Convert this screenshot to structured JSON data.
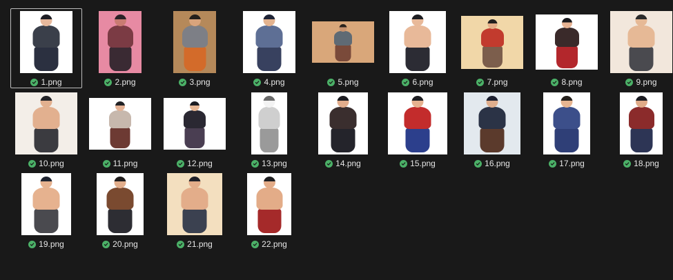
{
  "window": {
    "view": "file-grid"
  },
  "colors": {
    "background": "#191919",
    "label": "#e6e6e6",
    "sync_ok": "#4bb067",
    "selection": "#bdbdbd"
  },
  "files": [
    {
      "name": "1.png",
      "selected": true,
      "bg": "#ffffff",
      "skin": "#e6b89c",
      "hair": "#1e1e24",
      "top": "#3a3f4a",
      "bottom": "#2b3040",
      "icon": "check-circle-icon"
    },
    {
      "name": "2.png",
      "selected": false,
      "bg": "#e78aa3",
      "skin": "#c97b72",
      "hair": "#2a2026",
      "top": "#7b3b44",
      "bottom": "#3a2a33",
      "icon": "check-circle-icon"
    },
    {
      "name": "3.png",
      "selected": false,
      "bg": "#b5895a",
      "skin": "#d9a47c",
      "hair": "#24201c",
      "top": "#7d7f86",
      "bottom": "#d36b2a",
      "icon": "check-circle-icon"
    },
    {
      "name": "4.png",
      "selected": false,
      "bg": "#ffffff",
      "skin": "#e3b38f",
      "hair": "#1f2436",
      "top": "#5e6f95",
      "bottom": "#38415f",
      "icon": "check-circle-icon"
    },
    {
      "name": "5.png",
      "selected": false,
      "bg": "#d9a77a",
      "skin": "#c9936f",
      "hair": "#2a221c",
      "top": "#5f6a74",
      "bottom": "#7a4a3a",
      "icon": "check-circle-icon"
    },
    {
      "name": "6.png",
      "selected": false,
      "bg": "#ffffff",
      "skin": "#e8b999",
      "hair": "#1e1e22",
      "top": "#e8b999",
      "bottom": "#2c2c34",
      "icon": "check-circle-icon"
    },
    {
      "name": "7.png",
      "selected": false,
      "bg": "#f1d7a8",
      "skin": "#e3ad87",
      "hair": "#22201f",
      "top": "#c23b2e",
      "bottom": "#7c5e4c",
      "icon": "check-circle-icon"
    },
    {
      "name": "8.png",
      "selected": false,
      "bg": "#ffffff",
      "skin": "#e7b393",
      "hair": "#1a1a1e",
      "top": "#3a2a2a",
      "bottom": "#b3272c",
      "icon": "check-circle-icon"
    },
    {
      "name": "9.png",
      "selected": false,
      "bg": "#f2e7dc",
      "skin": "#e6b996",
      "hair": "#2b2b2b",
      "top": "#e6b996",
      "bottom": "#4a4a4f",
      "icon": "check-circle-icon"
    },
    {
      "name": "10.png",
      "selected": false,
      "bg": "#f3eee8",
      "skin": "#e2b08f",
      "hair": "#232327",
      "top": "#e2b08f",
      "bottom": "#3b3b40",
      "icon": "check-circle-icon"
    },
    {
      "name": "11.png",
      "selected": false,
      "bg": "#ffffff",
      "skin": "#e4b295",
      "hair": "#222225",
      "top": "#c7b8ad",
      "bottom": "#6d3a33",
      "icon": "check-circle-icon"
    },
    {
      "name": "12.png",
      "selected": false,
      "bg": "#ffffff",
      "skin": "#e8b896",
      "hair": "#1c1c22",
      "top": "#2a2832",
      "bottom": "#4a3e52",
      "icon": "check-circle-icon"
    },
    {
      "name": "13.png",
      "selected": false,
      "bg": "#ffffff",
      "skin": "#f3f3f3",
      "hair": "#6a6a6a",
      "top": "#cfcfcf",
      "bottom": "#9a9a9a",
      "icon": "check-circle-icon"
    },
    {
      "name": "14.png",
      "selected": false,
      "bg": "#ffffff",
      "skin": "#e2ad8c",
      "hair": "#1d1d22",
      "top": "#3a2e2e",
      "bottom": "#24242b",
      "icon": "check-circle-icon"
    },
    {
      "name": "15.png",
      "selected": false,
      "bg": "#ffffff",
      "skin": "#e6b18f",
      "hair": "#1e1e22",
      "top": "#c32c2c",
      "bottom": "#2c3f8c",
      "icon": "check-circle-icon"
    },
    {
      "name": "16.png",
      "selected": false,
      "bg": "#e3e9ee",
      "skin": "#dfae8d",
      "hair": "#1d2030",
      "top": "#2b3346",
      "bottom": "#5b3a2c",
      "icon": "check-circle-icon"
    },
    {
      "name": "17.png",
      "selected": false,
      "bg": "#ffffff",
      "skin": "#e7b591",
      "hair": "#25201c",
      "top": "#3c4f8a",
      "bottom": "#2f3f77",
      "icon": "check-circle-icon"
    },
    {
      "name": "18.png",
      "selected": false,
      "bg": "#ffffff",
      "skin": "#e0ab88",
      "hair": "#1c1c22",
      "top": "#8b2b2b",
      "bottom": "#2d3555",
      "icon": "check-circle-icon"
    },
    {
      "name": "19.png",
      "selected": false,
      "bg": "#ffffff",
      "skin": "#e6b28f",
      "hair": "#1f2430",
      "top": "#e6b28f",
      "bottom": "#4a4a4f",
      "icon": "check-circle-icon"
    },
    {
      "name": "20.png",
      "selected": false,
      "bg": "#ffffff",
      "skin": "#e2ae8c",
      "hair": "#201d1d",
      "top": "#7a4a30",
      "bottom": "#2d2d33",
      "icon": "check-circle-icon"
    },
    {
      "name": "21.png",
      "selected": false,
      "bg": "#f3dfbf",
      "skin": "#e3ad8a",
      "hair": "#1f2028",
      "top": "#e3ad8a",
      "bottom": "#3b4150",
      "icon": "check-circle-icon"
    },
    {
      "name": "22.png",
      "selected": false,
      "bg": "#ffffff",
      "skin": "#e3ac88",
      "hair": "#1f1f22",
      "top": "#e3ac88",
      "bottom": "#a52a2a",
      "icon": "check-circle-icon"
    }
  ]
}
